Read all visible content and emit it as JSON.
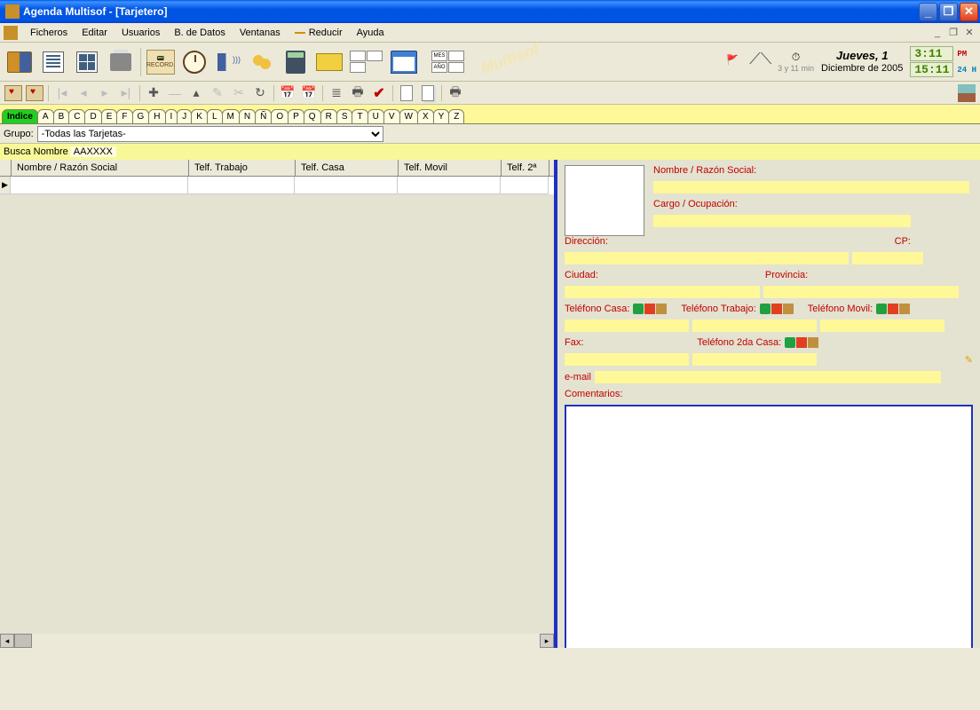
{
  "window": {
    "title": "Agenda Multisof - [Tarjetero]"
  },
  "menu": {
    "ficheros": "Ficheros",
    "editar": "Editar",
    "usuarios": "Usuarios",
    "bdatos": "B. de Datos",
    "ventanas": "Ventanas",
    "reducir": "Reducir",
    "ayuda": "Ayuda"
  },
  "toolbar1": {
    "record_label": "RECORD.",
    "mes_label": "MES",
    "ano_label": "AÑO"
  },
  "status": {
    "timer": "3 y 11 min",
    "day": "Jueves, 1",
    "month": "Diciembre de 2005",
    "time12": "3:11",
    "time12suf": "PM",
    "time24": "15:11",
    "time24suf": "24 H"
  },
  "alpha": {
    "indice": "Indice",
    "letters": [
      "A",
      "B",
      "C",
      "D",
      "E",
      "F",
      "G",
      "H",
      "I",
      "J",
      "K",
      "L",
      "M",
      "N",
      "Ñ",
      "O",
      "P",
      "Q",
      "R",
      "S",
      "T",
      "U",
      "V",
      "W",
      "X",
      "Y",
      "Z"
    ]
  },
  "filter": {
    "grupo_label": "Grupo:",
    "grupo_value": "-Todas las Tarjetas-"
  },
  "search": {
    "label": "Busca  Nombre",
    "value": "AAXXXX"
  },
  "grid": {
    "col1": "Nombre / Razón Social",
    "col2": "Telf. Trabajo",
    "col3": "Telf. Casa",
    "col4": "Telf. Movil",
    "col5": "Telf. 2ª"
  },
  "detail": {
    "nombre": "Nombre / Razón Social:",
    "cargo": "Cargo / Ocupación:",
    "direccion": "Dirección:",
    "cp": "CP:",
    "ciudad": "Ciudad:",
    "provincia": "Provincia:",
    "tel_casa": "Teléfono Casa:",
    "tel_trabajo": "Teléfono Trabajo:",
    "tel_movil": "Teléfono Movil:",
    "fax": "Fax:",
    "tel_2casa": "Teléfono 2da Casa:",
    "email": "e-mail",
    "comentarios": "Comentarios:"
  }
}
